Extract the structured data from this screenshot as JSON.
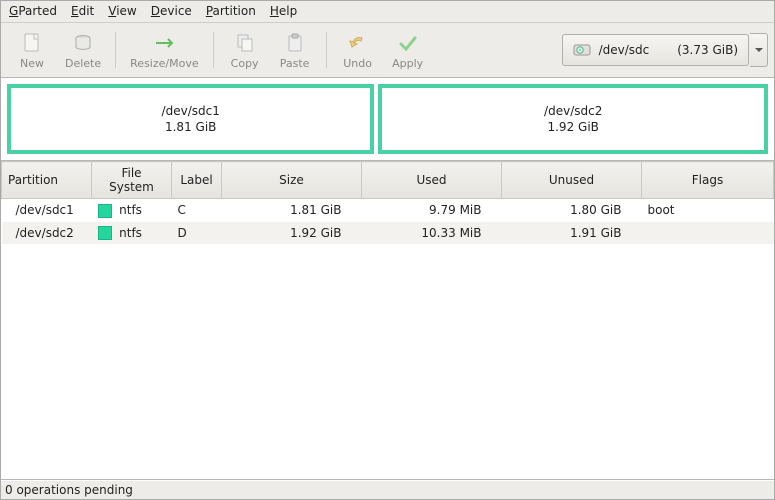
{
  "menu": {
    "gparted": "GParted",
    "edit": "Edit",
    "view": "View",
    "device": "Device",
    "partition": "Partition",
    "help": "Help"
  },
  "toolbar": {
    "new": "New",
    "delete": "Delete",
    "resize_move": "Resize/Move",
    "copy": "Copy",
    "paste": "Paste",
    "undo": "Undo",
    "apply": "Apply"
  },
  "device_selector": {
    "device": "/dev/sdc",
    "size": "(3.73 GiB)"
  },
  "partmap": {
    "blocks": [
      {
        "name": "/dev/sdc1",
        "size": "1.81 GiB",
        "fraction": 0.485
      },
      {
        "name": "/dev/sdc2",
        "size": "1.92 GiB",
        "fraction": 0.515
      }
    ]
  },
  "table": {
    "headers": {
      "partition": "Partition",
      "filesystem": "File System",
      "label": "Label",
      "size": "Size",
      "used": "Used",
      "unused": "Unused",
      "flags": "Flags"
    },
    "rows": [
      {
        "partition": "/dev/sdc1",
        "fs_color": "#23d69e",
        "fs": "ntfs",
        "label": "C",
        "size": "1.81 GiB",
        "used": "9.79 MiB",
        "unused": "1.80 GiB",
        "flags": "boot"
      },
      {
        "partition": "/dev/sdc2",
        "fs_color": "#23d69e",
        "fs": "ntfs",
        "label": "D",
        "size": "1.92 GiB",
        "used": "10.33 MiB",
        "unused": "1.91 GiB",
        "flags": ""
      }
    ]
  },
  "status": "0 operations pending",
  "colors": {
    "accent": "#49d1a4",
    "ntfs": "#23d69e"
  }
}
